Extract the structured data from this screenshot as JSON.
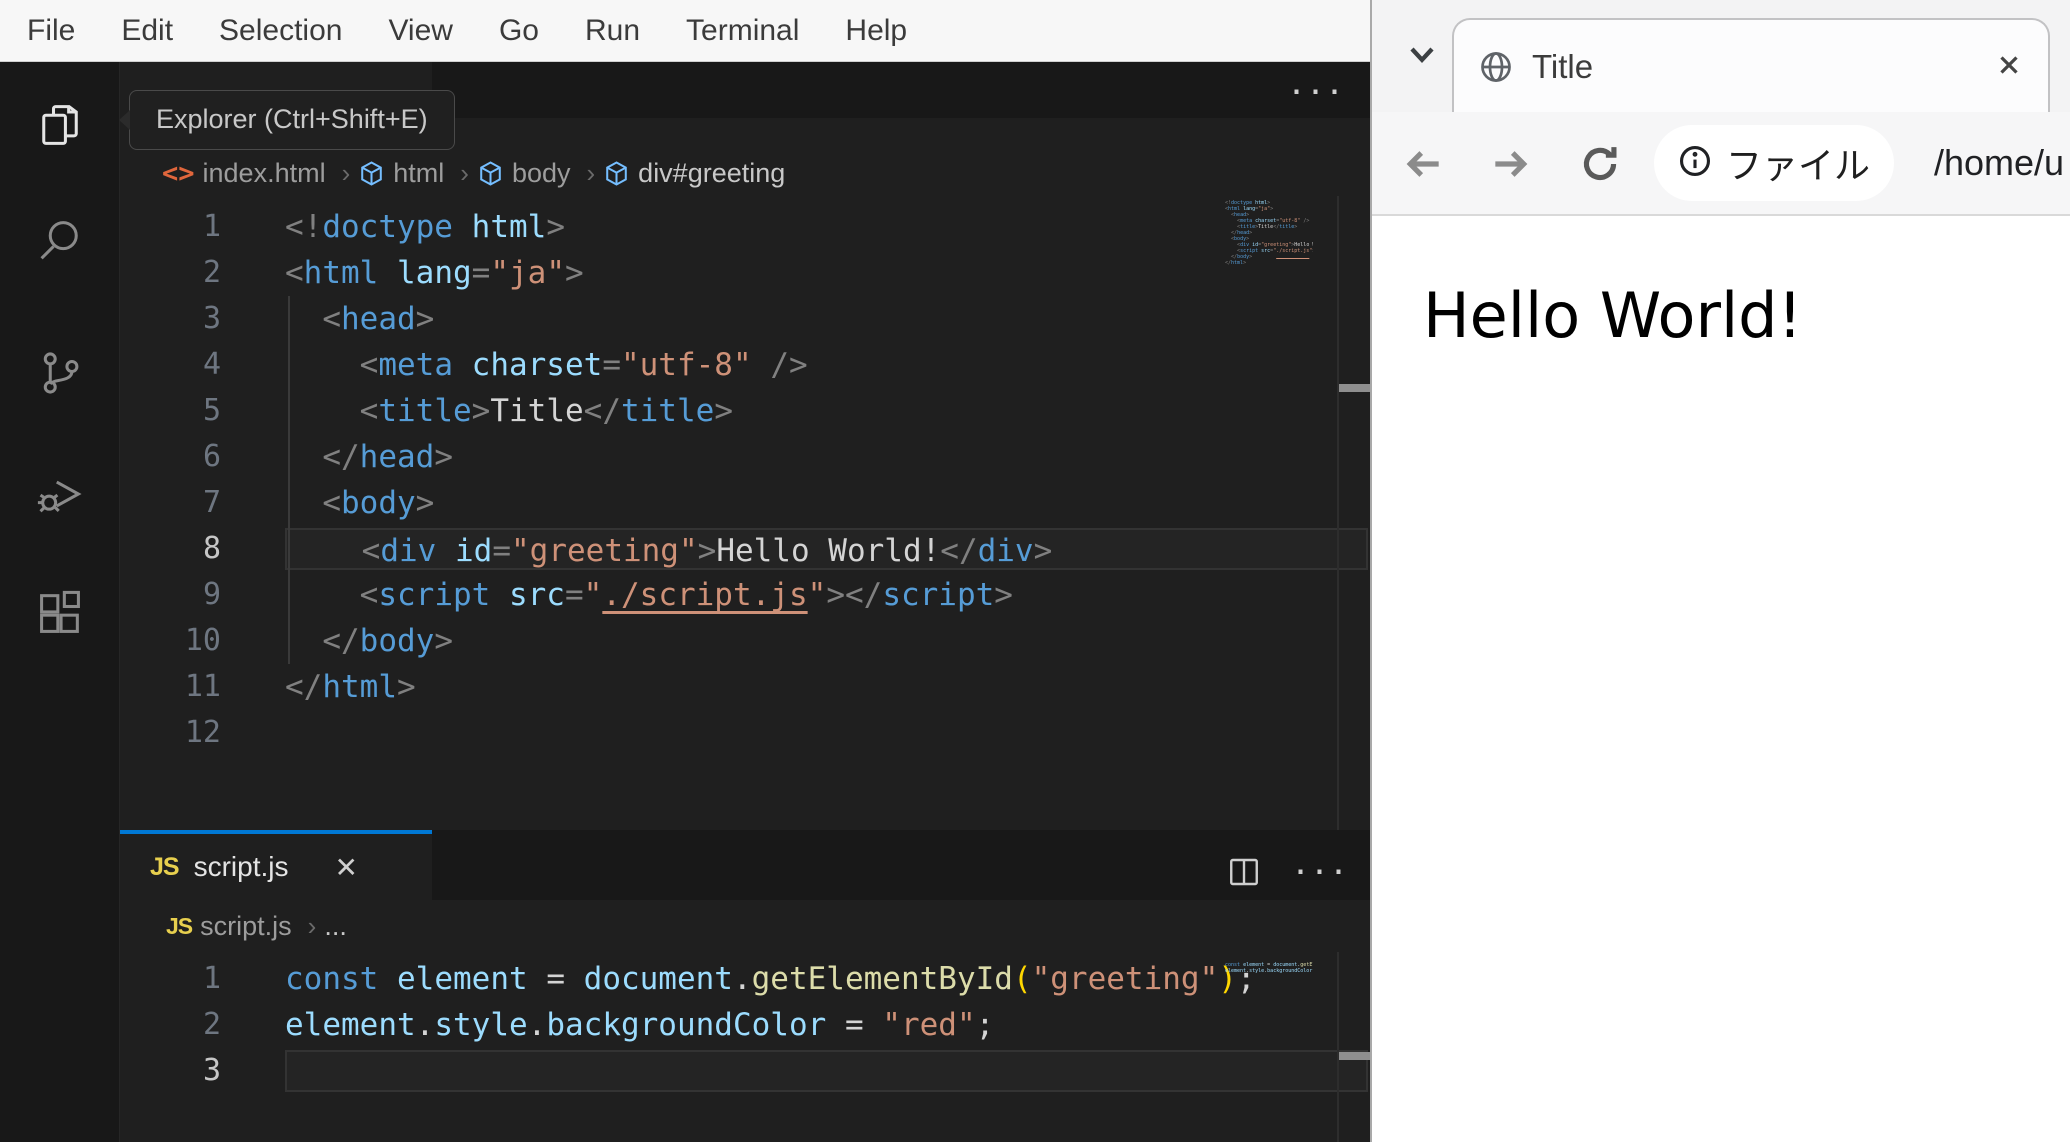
{
  "colors": {
    "accent_blue": "#0078d4",
    "editor_bg": "#1f1f1f",
    "menu_bg": "#f7f7f7",
    "heading_bg": "#ec3323",
    "tag_blue": "#569cd6",
    "string_orange": "#ce9178"
  },
  "menubar": {
    "items": [
      "File",
      "Edit",
      "Selection",
      "View",
      "Go",
      "Run",
      "Terminal",
      "Help"
    ]
  },
  "activity_bar": {
    "active_item": "explorer",
    "items": [
      "explorer",
      "search",
      "source-control",
      "run-and-debug",
      "extensions"
    ]
  },
  "tooltip": {
    "label": "Explorer (Ctrl+Shift+E)"
  },
  "editor_html": {
    "tab_label": "index.html",
    "actions_more": "···",
    "breadcrumbs": [
      {
        "icon": "code-tag",
        "label": "index.html"
      },
      {
        "icon": "cube",
        "label": "html"
      },
      {
        "icon": "cube",
        "label": "body"
      },
      {
        "icon": "cube",
        "label": "div#greeting"
      }
    ],
    "cursor_line": 8,
    "lines": [
      [
        [
          "p",
          "<!"
        ],
        [
          "tag",
          "doctype"
        ],
        [
          "pl",
          " "
        ],
        [
          "attr",
          "html"
        ],
        [
          "p",
          ">"
        ]
      ],
      [
        [
          "p",
          "<"
        ],
        [
          "tag",
          "html"
        ],
        [
          "pl",
          " "
        ],
        [
          "attr",
          "lang"
        ],
        [
          "p",
          "="
        ],
        [
          "str",
          "\"ja\""
        ],
        [
          "p",
          ">"
        ]
      ],
      [
        [
          "pl",
          "  "
        ],
        [
          "p",
          "<"
        ],
        [
          "tag",
          "head"
        ],
        [
          "p",
          ">"
        ]
      ],
      [
        [
          "pl",
          "    "
        ],
        [
          "p",
          "<"
        ],
        [
          "tag",
          "meta"
        ],
        [
          "pl",
          " "
        ],
        [
          "attr",
          "charset"
        ],
        [
          "p",
          "="
        ],
        [
          "str",
          "\"utf-8\""
        ],
        [
          "pl",
          " "
        ],
        [
          "p",
          "/>"
        ]
      ],
      [
        [
          "pl",
          "    "
        ],
        [
          "p",
          "<"
        ],
        [
          "tag",
          "title"
        ],
        [
          "p",
          ">"
        ],
        [
          "txt",
          "Title"
        ],
        [
          "p",
          "</"
        ],
        [
          "tag",
          "title"
        ],
        [
          "p",
          ">"
        ]
      ],
      [
        [
          "pl",
          "  "
        ],
        [
          "p",
          "</"
        ],
        [
          "tag",
          "head"
        ],
        [
          "p",
          ">"
        ]
      ],
      [
        [
          "pl",
          "  "
        ],
        [
          "p",
          "<"
        ],
        [
          "tag",
          "body"
        ],
        [
          "p",
          ">"
        ]
      ],
      [
        [
          "pl",
          "    "
        ],
        [
          "p",
          "<"
        ],
        [
          "tag",
          "div"
        ],
        [
          "pl",
          " "
        ],
        [
          "attr",
          "id"
        ],
        [
          "p",
          "="
        ],
        [
          "str",
          "\"greeting\""
        ],
        [
          "p",
          ">"
        ],
        [
          "txt",
          "Hello World!"
        ],
        [
          "p",
          "</"
        ],
        [
          "tag",
          "div"
        ],
        [
          "p",
          ">"
        ]
      ],
      [
        [
          "pl",
          "    "
        ],
        [
          "p",
          "<"
        ],
        [
          "tag",
          "script"
        ],
        [
          "pl",
          " "
        ],
        [
          "attr",
          "src"
        ],
        [
          "p",
          "="
        ],
        [
          "str",
          "\""
        ],
        [
          "lnk",
          "./script.js"
        ],
        [
          "str",
          "\""
        ],
        [
          "p",
          ">"
        ],
        [
          "p",
          "</"
        ],
        [
          "tag",
          "script"
        ],
        [
          "p",
          ">"
        ]
      ],
      [
        [
          "pl",
          "  "
        ],
        [
          "p",
          "</"
        ],
        [
          "tag",
          "body"
        ],
        [
          "p",
          ">"
        ]
      ],
      [
        [
          "p",
          "</"
        ],
        [
          "tag",
          "html"
        ],
        [
          "p",
          ">"
        ]
      ],
      []
    ]
  },
  "editor_js": {
    "tab_label": "script.js",
    "tab_close": "✕",
    "actions_more": "···",
    "breadcrumbs": [
      {
        "icon": "js",
        "label": "script.js"
      },
      {
        "icon": null,
        "label": "..."
      }
    ],
    "cursor_line": 3,
    "lines": [
      [
        [
          "kw",
          "const"
        ],
        [
          "pl",
          " "
        ],
        [
          "attr",
          "element"
        ],
        [
          "op",
          " = "
        ],
        [
          "attr",
          "document"
        ],
        [
          "op",
          "."
        ],
        [
          "fn",
          "getElementById"
        ],
        [
          "br",
          "("
        ],
        [
          "str",
          "\"greeting\""
        ],
        [
          "br",
          ")"
        ],
        [
          "op",
          ";"
        ]
      ],
      [
        [
          "attr",
          "element"
        ],
        [
          "op",
          "."
        ],
        [
          "attr",
          "style"
        ],
        [
          "op",
          "."
        ],
        [
          "attr",
          "backgroundColor"
        ],
        [
          "op",
          " = "
        ],
        [
          "str",
          "\"red\""
        ],
        [
          "op",
          ";"
        ]
      ],
      []
    ]
  },
  "browser": {
    "tab": {
      "title": "Title"
    },
    "address": {
      "chip_label": "ファイル",
      "url": "/home/u"
    },
    "page": {
      "heading": "Hello World!",
      "heading_bg": "#ec3323"
    }
  }
}
